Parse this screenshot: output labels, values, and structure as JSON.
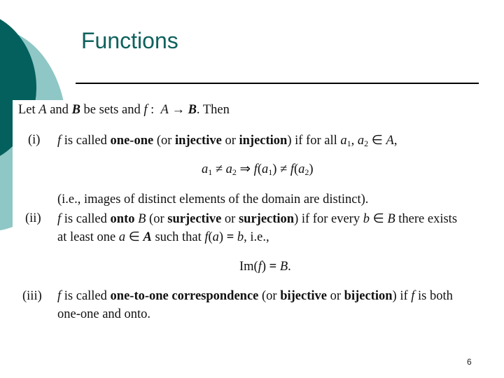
{
  "slide": {
    "title": "Functions",
    "page_number": "6",
    "colors": {
      "title": "#0f615d",
      "dark_teal": "#03605c",
      "light_teal": "#8fc6c6"
    }
  },
  "content": {
    "intro": "Let A and B be sets and f : A → B. Then",
    "items": [
      {
        "label": "(i)",
        "text": "f is called one-one (or injective or injection) if for all a1, a2 ∈ A,",
        "formula": "a1 ≠ a2 ⇒ f(a1) ≠ f(a2)",
        "note": "(i.e., images of distinct elements of the domain are distinct)."
      },
      {
        "label": "(ii)",
        "text": "f is called onto B (or surjective or surjection) if for every b ∈ B there exists",
        "text2": "at least one a ∈ A such that f(a) = b, i.e.,",
        "formula": "Im(f) = B."
      },
      {
        "label": "(iii)",
        "text": "f is called one-to-one correspondence (or bijective or bijection) if f is both",
        "text2": "one-one and onto."
      }
    ]
  }
}
